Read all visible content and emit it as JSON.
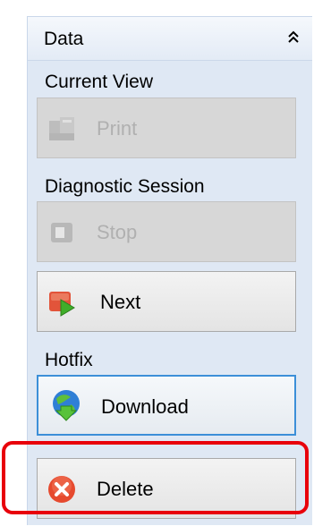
{
  "header": {
    "title": "Data"
  },
  "groups": {
    "current_view": {
      "label": "Current View",
      "buttons": {
        "print": "Print"
      }
    },
    "diagnostic_session": {
      "label": "Diagnostic Session",
      "buttons": {
        "stop": "Stop",
        "next": "Next"
      }
    },
    "hotfix": {
      "label": "Hotfix",
      "buttons": {
        "download": "Download",
        "delete": "Delete"
      }
    }
  },
  "colors": {
    "panel_background": "#dfe8f4",
    "focus_border": "#3c8fd8",
    "highlight_border": "#e8000b"
  },
  "icons": {
    "collapse": "double-chevron-up-icon",
    "print": "printer-icon",
    "stop": "stop-icon",
    "next": "next-play-icon",
    "download": "download-globe-icon",
    "delete": "delete-x-icon"
  },
  "state": {
    "print_enabled": false,
    "stop_enabled": false,
    "focused_button": "download",
    "annotated_button": "delete"
  }
}
